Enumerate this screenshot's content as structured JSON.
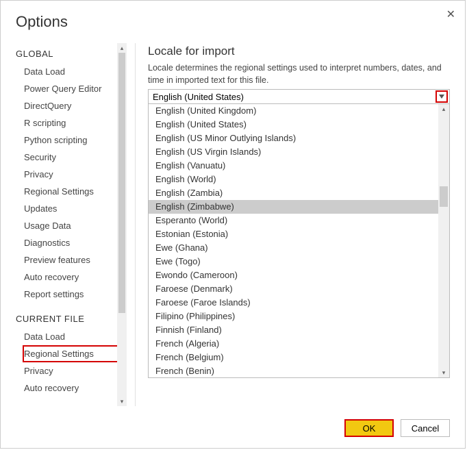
{
  "dialog": {
    "title": "Options"
  },
  "sidebar": {
    "global_label": "GLOBAL",
    "current_file_label": "CURRENT FILE",
    "global_items": [
      "Data Load",
      "Power Query Editor",
      "DirectQuery",
      "R scripting",
      "Python scripting",
      "Security",
      "Privacy",
      "Regional Settings",
      "Updates",
      "Usage Data",
      "Diagnostics",
      "Preview features",
      "Auto recovery",
      "Report settings"
    ],
    "current_items": [
      "Data Load",
      "Regional Settings",
      "Privacy",
      "Auto recovery"
    ]
  },
  "content": {
    "heading": "Locale for import",
    "description": "Locale determines the regional settings used to interpret numbers, dates, and time in imported text for this file.",
    "selected": "English (United States)",
    "options": [
      "English (United Kingdom)",
      "English (United States)",
      "English (US Minor Outlying Islands)",
      "English (US Virgin Islands)",
      "English (Vanuatu)",
      "English (World)",
      "English (Zambia)",
      "English (Zimbabwe)",
      "Esperanto (World)",
      "Estonian (Estonia)",
      "Ewe (Ghana)",
      "Ewe (Togo)",
      "Ewondo (Cameroon)",
      "Faroese (Denmark)",
      "Faroese (Faroe Islands)",
      "Filipino (Philippines)",
      "Finnish (Finland)",
      "French (Algeria)",
      "French (Belgium)",
      "French (Benin)"
    ],
    "hover_index": 7
  },
  "footer": {
    "ok": "OK",
    "cancel": "Cancel"
  }
}
